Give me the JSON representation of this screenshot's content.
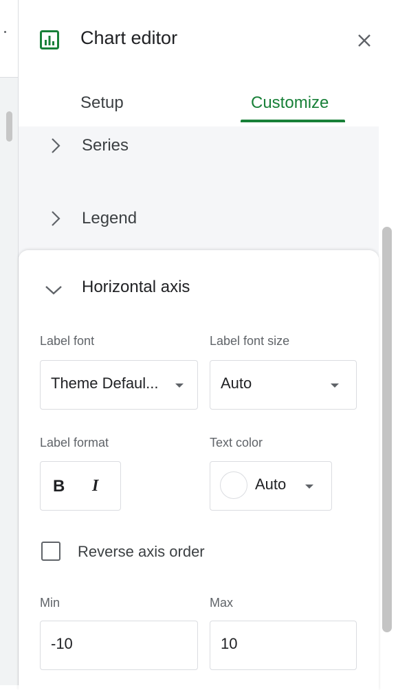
{
  "editor": {
    "title": "Chart editor",
    "tabs": [
      {
        "label": "Setup",
        "active": false
      },
      {
        "label": "Customize",
        "active": true
      }
    ]
  },
  "sections": {
    "series_label": "Series",
    "legend_label": "Legend",
    "horizontal_axis_label": "Horizontal axis"
  },
  "horizontal_axis": {
    "label_font": {
      "label": "Label font",
      "value": "Theme Defaul..."
    },
    "label_font_size": {
      "label": "Label font size",
      "value": "Auto"
    },
    "label_format": {
      "label": "Label format",
      "bold": "B",
      "italic": "I"
    },
    "text_color": {
      "label": "Text color",
      "value": "Auto"
    },
    "reverse_axis_order": {
      "label": "Reverse axis order",
      "checked": false
    },
    "min": {
      "label": "Min",
      "value": "-10"
    },
    "max": {
      "label": "Max",
      "value": "10"
    }
  },
  "colors": {
    "accent": "#188038",
    "panel_gray": "#f5f6f8"
  },
  "icons": {
    "chart": "chart-icon",
    "close": "close-icon",
    "chevron_right": "chevron-right-icon",
    "chevron_down": "chevron-down-icon",
    "caret_down": "caret-down-icon"
  }
}
